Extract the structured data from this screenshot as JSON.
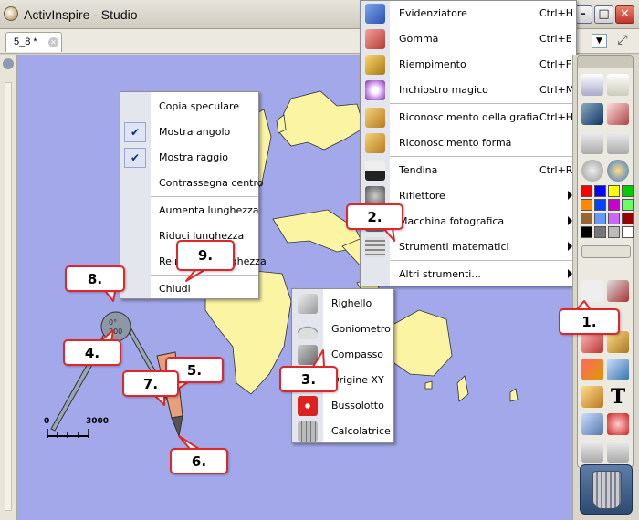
{
  "window": {
    "title": "ActivInspire - Studio"
  },
  "tabs": [
    {
      "label": "5_8 *"
    }
  ],
  "compass_menu": {
    "items": [
      {
        "label": "Copia speculare",
        "checked": false
      },
      {
        "label": "Mostra angolo",
        "checked": true
      },
      {
        "label": "Mostra raggio",
        "checked": true
      },
      {
        "label": "Contrassegna centro",
        "checked": false
      },
      {
        "label": "Aumenta lunghezza",
        "checked": false
      },
      {
        "label": "Riduci lunghezza",
        "checked": false
      },
      {
        "label": "Reimposta lunghezza",
        "checked": false
      },
      {
        "label": "Chiudi",
        "checked": false
      }
    ]
  },
  "tools_menu": {
    "items": [
      {
        "label": "Evidenziatore",
        "shortcut": "Ctrl+H",
        "icon": "highlighter-icon"
      },
      {
        "label": "Gomma",
        "shortcut": "Ctrl+E",
        "icon": "eraser-icon"
      },
      {
        "label": "Riempimento",
        "shortcut": "Ctrl+F",
        "icon": "fill-icon"
      },
      {
        "label": "Inchiostro magico",
        "shortcut": "Ctrl+M",
        "icon": "magic-ink-icon"
      },
      {
        "label": "Riconoscimento della grafia",
        "shortcut": "Ctrl+H",
        "icon": "handwriting-recognition-icon"
      },
      {
        "label": "Riconoscimento forma",
        "shortcut": "",
        "icon": "shape-recognition-icon"
      },
      {
        "label": "Tendina",
        "shortcut": "Ctrl+R",
        "icon": "reveal-blind-icon"
      },
      {
        "label": "Riflettore",
        "shortcut": "",
        "icon": "spotlight-icon",
        "submenu": true
      },
      {
        "label": "Macchina fotografica",
        "shortcut": "",
        "icon": "camera-icon",
        "submenu": true
      },
      {
        "label": "Strumenti matematici",
        "shortcut": "",
        "icon": "math-tools-icon",
        "submenu": true
      },
      {
        "label": "Altri strumenti...",
        "shortcut": "",
        "icon": "",
        "submenu": true
      }
    ]
  },
  "math_submenu": {
    "items": [
      {
        "label": "Righello",
        "icon": "ruler-icon"
      },
      {
        "label": "Goniometro",
        "icon": "protractor-icon"
      },
      {
        "label": "Compasso",
        "icon": "compass-icon"
      },
      {
        "label": "Origine XY",
        "icon": "xy-origin-icon"
      },
      {
        "label": "Bussolotto",
        "icon": "dice-icon"
      },
      {
        "label": "Calcolatrice",
        "icon": "calculator-icon"
      }
    ]
  },
  "callouts": [
    "1.",
    "2.",
    "3.",
    "4.",
    "5.",
    "6.",
    "7.",
    "8.",
    "9."
  ],
  "scale_bar": {
    "start": "0",
    "end": "3000"
  },
  "compass_readouts": {
    "angle": "0°",
    "radius": "200"
  },
  "palette_colors": [
    "#ff0000",
    "#0000ff",
    "#ffff00",
    "#00cc00",
    "#ff8800",
    "#0044ff",
    "#cc00cc",
    "#66ff66",
    "#996633",
    "#6699ff",
    "#cc66ff",
    "#990000",
    "#000000",
    "#777777",
    "#bbbbbb",
    "#ffffff"
  ],
  "colors": {
    "canvas": "#a3a8ea",
    "land": "#fbf5a3",
    "callout_border": "#e0262a"
  }
}
